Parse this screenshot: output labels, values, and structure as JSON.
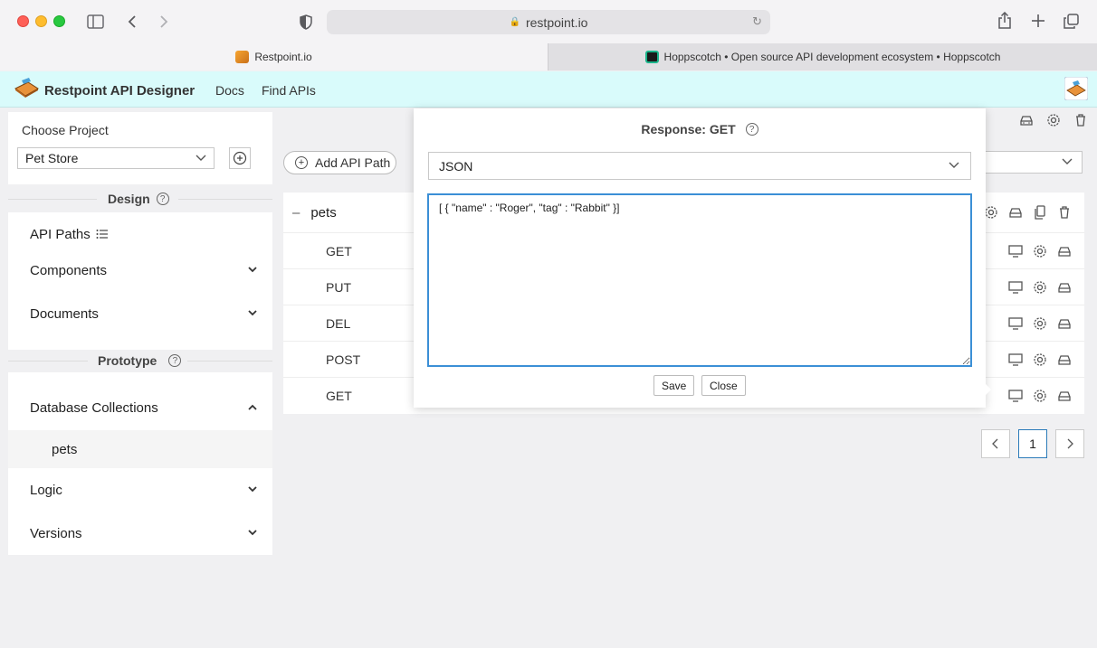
{
  "browser": {
    "url": "restpoint.io",
    "tabs": [
      {
        "label": "Restpoint.io",
        "active": true
      },
      {
        "label": "Hoppscotch • Open source API development ecosystem • Hoppscotch",
        "active": false
      }
    ]
  },
  "header": {
    "brand": "Restpoint API Designer",
    "nav": [
      "Docs",
      "Find APIs"
    ]
  },
  "sidebar": {
    "choose_project_label": "Choose Project",
    "selected_project": "Pet Store",
    "design_title": "Design",
    "design_items": [
      {
        "label": "API Paths"
      },
      {
        "label": "Components"
      },
      {
        "label": "Documents"
      }
    ],
    "prototype_title": "Prototype",
    "prototype_items": [
      {
        "label": "Database Collections"
      },
      {
        "label": "pets"
      },
      {
        "label": "Logic"
      },
      {
        "label": "Versions"
      }
    ]
  },
  "main": {
    "add_path_label": "Add API Path",
    "path_name": "pets",
    "methods": [
      "GET",
      "PUT",
      "DEL",
      "POST",
      "GET"
    ],
    "pagination": {
      "prev": "<",
      "current": "1",
      "next": ">"
    }
  },
  "popover": {
    "title": "Response: GET",
    "format": "JSON",
    "body": "[ { \"name\" : \"Roger\", \"tag\" : \"Rabbit\" }]",
    "save_label": "Save",
    "close_label": "Close"
  },
  "icons": {
    "help": "?",
    "collapse": "–",
    "chevron": "⌄"
  }
}
